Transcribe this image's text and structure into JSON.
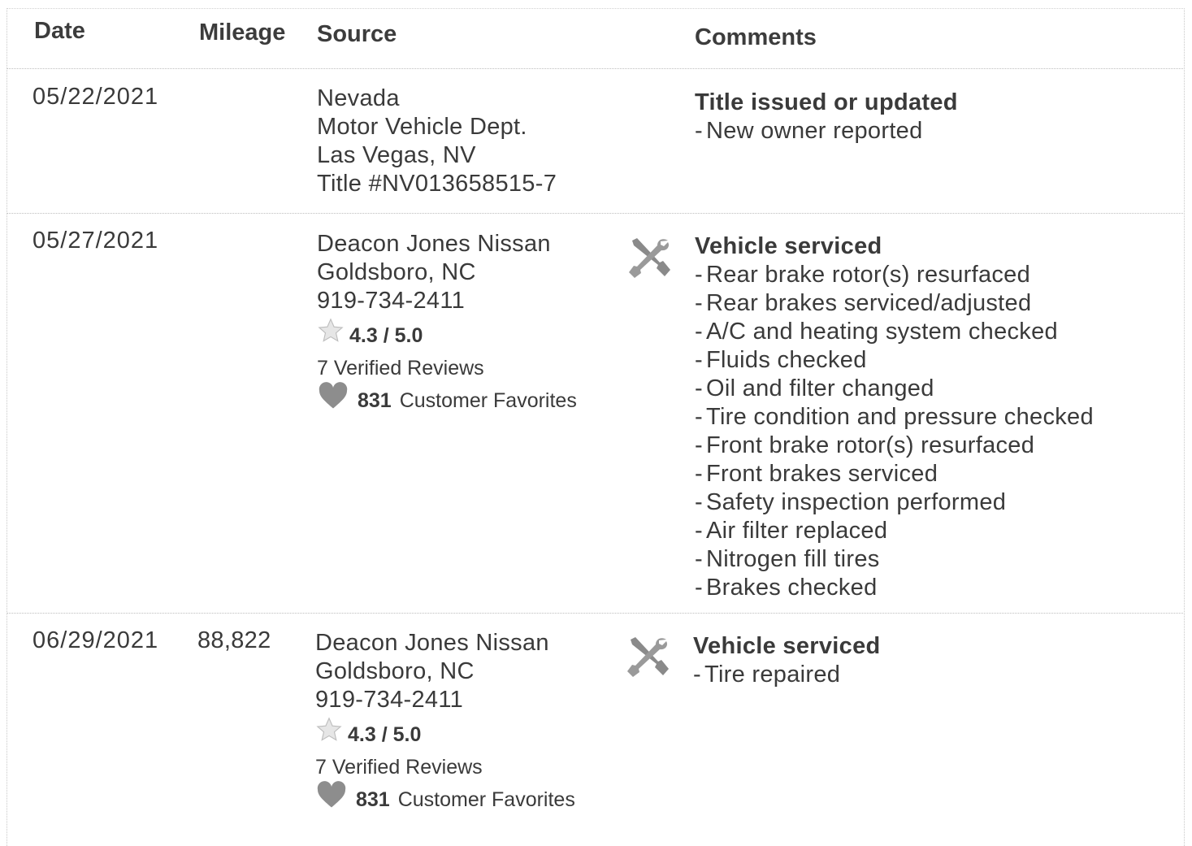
{
  "table": {
    "headers": {
      "date": "Date",
      "mileage": "Mileage",
      "source": "Source",
      "comments": "Comments"
    },
    "rows": [
      {
        "date": "05/22/2021",
        "mileage": "",
        "source": [
          "Nevada",
          "Motor Vehicle Dept.",
          "Las Vegas, NV",
          "Title #NV013658515-7"
        ],
        "comment_title": "Title issued or updated",
        "comment_items": [
          "New owner reported"
        ]
      },
      {
        "date": "05/27/2021",
        "mileage": "",
        "source": [
          "Deacon Jones Nissan",
          "Goldsboro, NC",
          "919-734-2411"
        ],
        "rating": "4.3 / 5.0",
        "reviews": "7 Verified Reviews",
        "favorites_count": "831",
        "favorites_label": "Customer Favorites",
        "icon": "wrench-screwdriver-icon",
        "comment_title": "Vehicle serviced",
        "comment_items": [
          "Rear brake rotor(s) resurfaced",
          "Rear brakes serviced/adjusted",
          "A/C and heating system checked",
          "Fluids checked",
          "Oil and filter changed",
          "Tire condition and pressure checked",
          "Front brake rotor(s) resurfaced",
          "Front brakes serviced",
          "Safety inspection performed",
          "Air filter replaced",
          "Nitrogen fill tires",
          "Brakes checked"
        ]
      },
      {
        "date": "06/29/2021",
        "mileage": "88,822",
        "source": [
          "Deacon Jones Nissan",
          "Goldsboro, NC",
          "919-734-2411"
        ],
        "rating": "4.3 / 5.0",
        "reviews": "7 Verified Reviews",
        "favorites_count": "831",
        "favorites_label": "Customer Favorites",
        "icon": "wrench-screwdriver-icon",
        "comment_title": "Vehicle serviced",
        "comment_items": [
          "Tire repaired"
        ]
      }
    ],
    "dash": "-"
  },
  "colors": {
    "text": "#3a3a3a",
    "icon_gray": "#8a8a8a",
    "divider": "#bdbdbd"
  }
}
